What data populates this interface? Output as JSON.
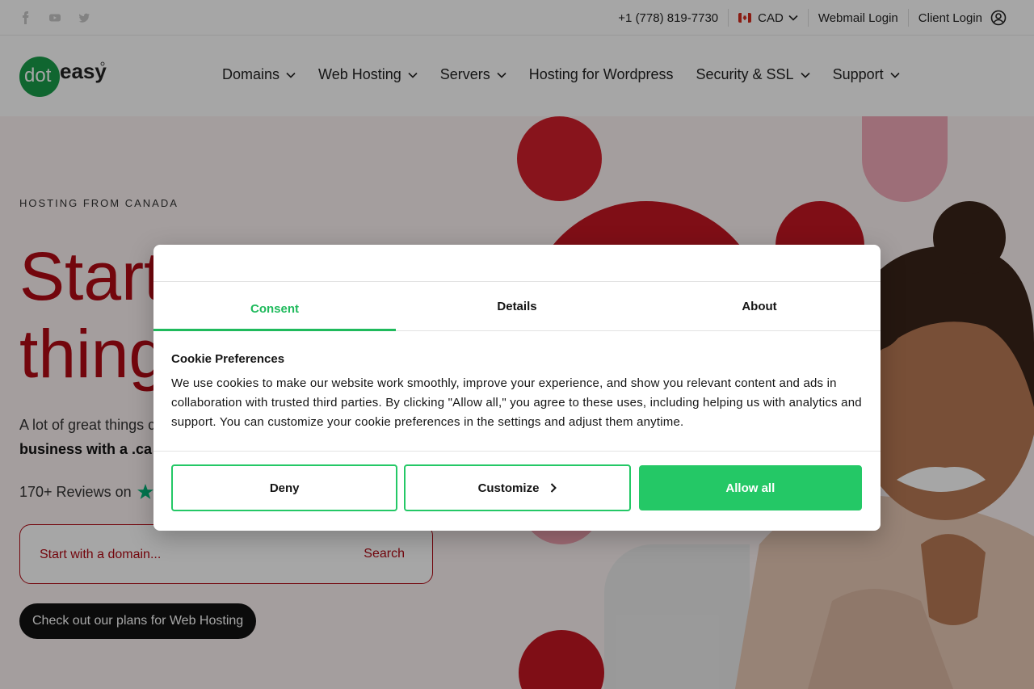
{
  "topbar": {
    "social_icons": [
      "facebook-icon",
      "youtube-icon",
      "twitter-icon"
    ],
    "phone": "+1 (778) 819-7730",
    "currency": "CAD",
    "webmail": "Webmail Login",
    "client_login": "Client Login"
  },
  "logo": {
    "dot": "dot",
    "easy": "easy"
  },
  "nav": {
    "items": [
      {
        "label": "Domains",
        "dropdown": true
      },
      {
        "label": "Web Hosting",
        "dropdown": true
      },
      {
        "label": "Servers",
        "dropdown": true
      },
      {
        "label": "Hosting for Wordpress",
        "dropdown": false
      },
      {
        "label": "Security & SSL",
        "dropdown": true
      },
      {
        "label": "Support",
        "dropdown": true
      }
    ]
  },
  "hero": {
    "eyebrow": "HOSTING FROM CANADA",
    "headline_line1": "Start",
    "headline_line2": "thing",
    "sub_line1": "A lot of great things c",
    "sub_line2": "business with a .ca",
    "reviews": "170+ Reviews on",
    "reviews_brand": "T",
    "search_placeholder": "Start with a domain...",
    "search_button": "Search",
    "plans_button": "Check out our plans for Web Hosting"
  },
  "cookie": {
    "tabs": [
      "Consent",
      "Details",
      "About"
    ],
    "active_tab": "Consent",
    "title": "Cookie Preferences",
    "text": "We use cookies to make our website work smoothly, improve your experience, and show you relevant content and ads in collaboration with trusted third parties. By clicking \"Allow all,\" you agree to these uses, including helping us with analytics and support. You can customize your cookie preferences in the settings and adjust them anytime.",
    "deny": "Deny",
    "customize": "Customize",
    "allow_all": "Allow all"
  },
  "colors": {
    "brand_red": "#b10a14",
    "accent_green": "#24c866",
    "logo_green": "#1a9d4a"
  }
}
